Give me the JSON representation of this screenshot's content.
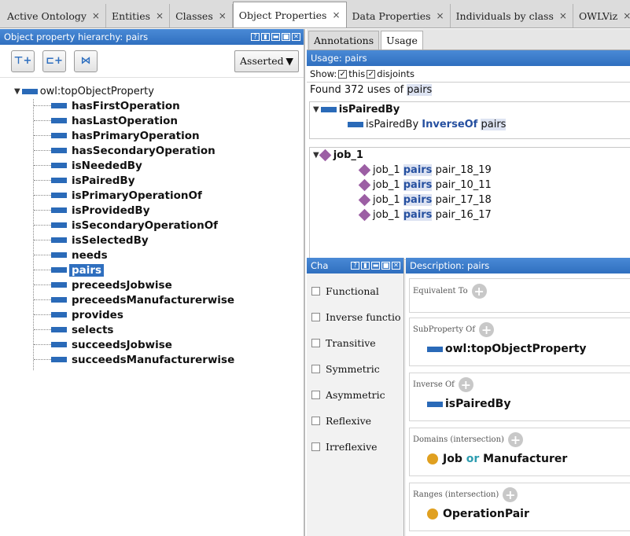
{
  "tabs": [
    {
      "label": "Active Ontology"
    },
    {
      "label": "Entities"
    },
    {
      "label": "Classes"
    },
    {
      "label": "Object Properties"
    },
    {
      "label": "Data Properties"
    },
    {
      "label": "Individuals by class"
    },
    {
      "label": "OWLViz"
    }
  ],
  "tab_close": "×",
  "left": {
    "title": "Object property hierarchy: pairs",
    "mode": "Asserted",
    "root": "owl:topObjectProperty",
    "items": [
      "hasFirstOperation",
      "hasLastOperation",
      "hasPrimaryOperation",
      "hasSecondaryOperation",
      "isNeededBy",
      "isPairedBy",
      "isPrimaryOperationOf",
      "isProvidedBy",
      "isSecondaryOperationOf",
      "isSelectedBy",
      "needs",
      "pairs",
      "preceedsJobwise",
      "preceedsManufacturerwise",
      "provides",
      "selects",
      "succeedsJobwise",
      "succeedsManufacturerwise"
    ],
    "selected": "pairs"
  },
  "right": {
    "subtabs": [
      "Annotations",
      "Usage"
    ],
    "usage_title": "Usage: pairs",
    "show_label": "Show:",
    "show_this": "this",
    "show_disjoints": "disjoints",
    "found_prefix": "Found 372 uses of",
    "found_term": "pairs",
    "group1": {
      "head": "isPairedBy",
      "line_subject": "isPairedBy",
      "line_keyword": "InverseOf",
      "line_object": "pairs"
    },
    "group2": {
      "head": "job_1",
      "rows": [
        {
          "subject": "job_1",
          "prop": "pairs",
          "object": "pair_18_19"
        },
        {
          "subject": "job_1",
          "prop": "pairs",
          "object": "pair_10_11"
        },
        {
          "subject": "job_1",
          "prop": "pairs",
          "object": "pair_17_18"
        },
        {
          "subject": "job_1",
          "prop": "pairs",
          "object": "pair_16_17"
        }
      ]
    }
  },
  "characteristics": {
    "title": "Cha",
    "items": [
      "Functional",
      "Inverse functio",
      "Transitive",
      "Symmetric",
      "Asymmetric",
      "Reflexive",
      "Irreflexive"
    ]
  },
  "description": {
    "title": "Description: pairs",
    "equivalent_to": "Equivalent To",
    "subproperty_of": "SubProperty Of",
    "subproperty_value": "owl:topObjectProperty",
    "inverse_of": "Inverse Of",
    "inverse_value": "isPairedBy",
    "domains": "Domains (intersection)",
    "domain_a": "Job",
    "domain_or": "or",
    "domain_b": "Manufacturer",
    "ranges": "Ranges (intersection)",
    "range_value": "OperationPair"
  },
  "colors": {
    "header_blue": "#2f6fbf",
    "property_blue": "#2a6ab8",
    "individual_purple": "#9c5fa4",
    "class_orange": "#e0a020"
  }
}
